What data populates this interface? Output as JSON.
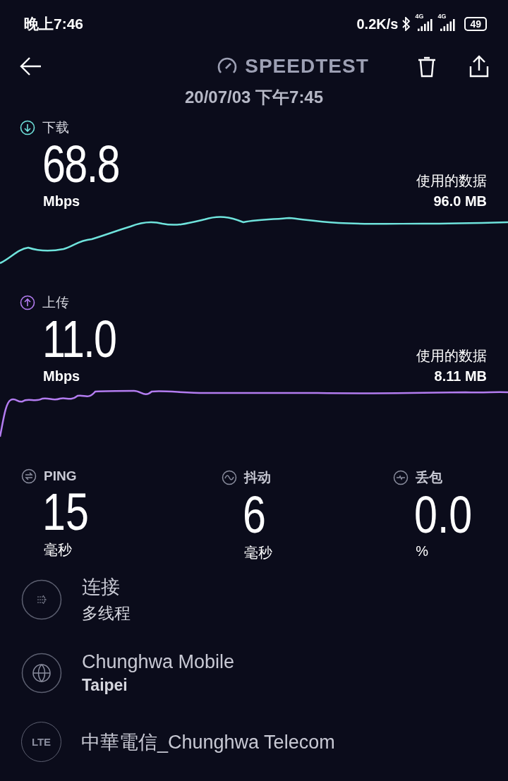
{
  "status_bar": {
    "time": "晚上7:46",
    "net_speed": "0.2K/s",
    "signals": [
      {
        "label": "4G"
      },
      {
        "label": "4G"
      }
    ],
    "battery": "49"
  },
  "header": {
    "title": "SPEEDTEST",
    "date": "20/07/03 下午7:45"
  },
  "results": [
    {
      "kind": "download",
      "label": "下载",
      "value": "68.8",
      "unit": "Mbps",
      "data_label": "使用的数据",
      "data_value": "96.0 MB"
    },
    {
      "kind": "upload",
      "label": "上传",
      "value": "11.0",
      "unit": "Mbps",
      "data_label": "使用的数据",
      "data_value": "8.11 MB"
    }
  ],
  "stats": [
    {
      "kind": "ping",
      "label": "PING",
      "value": "15",
      "unit": "毫秒"
    },
    {
      "kind": "jitter",
      "label": "抖动",
      "value": "6",
      "unit": "毫秒"
    },
    {
      "kind": "loss",
      "label": "丢包",
      "value": "0.0",
      "unit": "%"
    }
  ],
  "details": [
    {
      "kind": "connection",
      "title": "连接",
      "subtitle": "多线程"
    },
    {
      "kind": "server",
      "title": "Chunghwa Mobile",
      "subtitle": "Taipei"
    },
    {
      "kind": "carrier",
      "icon_text": "LTE",
      "title": "中華電信_Chunghwa Telecom"
    }
  ]
}
